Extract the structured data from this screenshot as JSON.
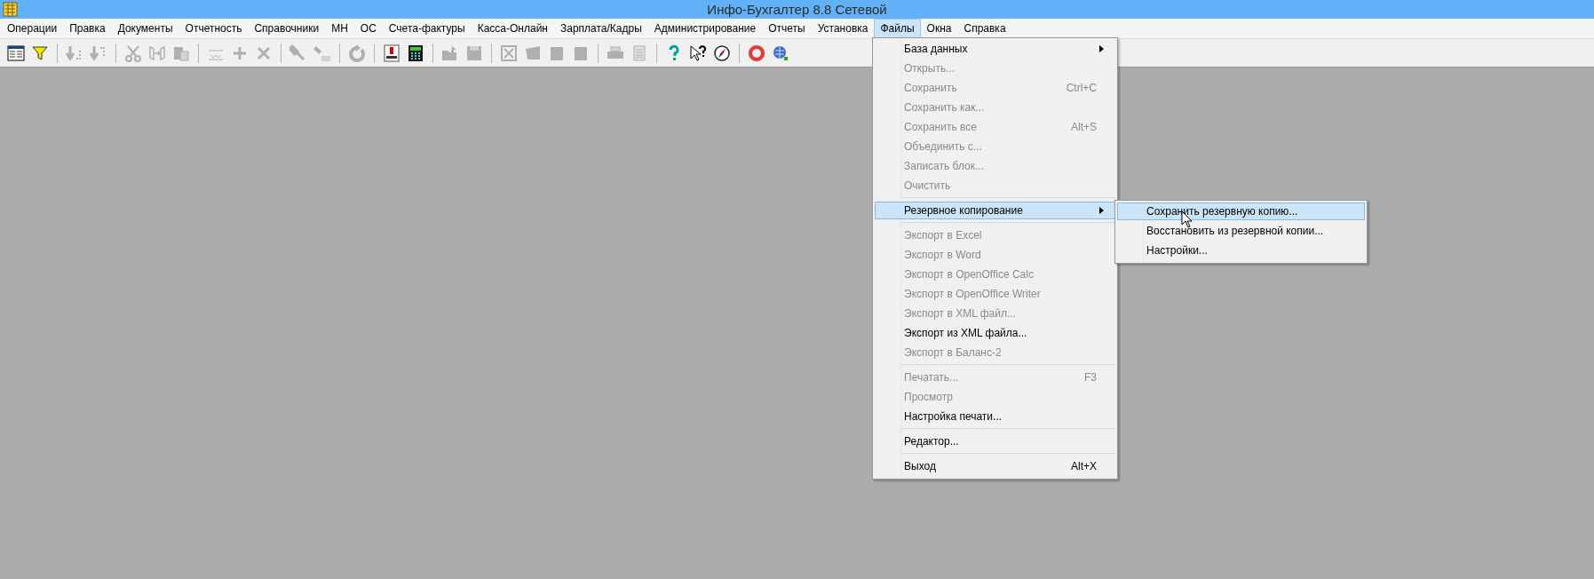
{
  "window": {
    "title": "Инфо-Бухгалтер 8.8 Сетевой"
  },
  "menu_bar": [
    {
      "label": "Операции",
      "selected": false
    },
    {
      "label": "Правка",
      "selected": false
    },
    {
      "label": "Документы",
      "selected": false
    },
    {
      "label": "Отчетность",
      "selected": false
    },
    {
      "label": "Справочники",
      "selected": false
    },
    {
      "label": "МН",
      "selected": false
    },
    {
      "label": "ОС",
      "selected": false
    },
    {
      "label": "Счета-фактуры",
      "selected": false
    },
    {
      "label": "Касса-Онлайн",
      "selected": false
    },
    {
      "label": "Зарплата/Кадры",
      "selected": false
    },
    {
      "label": "Администрирование",
      "selected": false
    },
    {
      "label": "Отчеты",
      "selected": false
    },
    {
      "label": "Установка",
      "selected": false
    },
    {
      "label": "Файлы",
      "selected": true
    },
    {
      "label": "Окна",
      "selected": false
    },
    {
      "label": "Справка",
      "selected": false
    }
  ],
  "toolbar": [
    [
      {
        "disabled": false
      },
      {
        "disabled": false
      }
    ],
    [
      {
        "disabled": true
      },
      {
        "disabled": true
      }
    ],
    [
      {
        "disabled": true
      },
      {
        "disabled": true
      },
      {
        "disabled": true
      }
    ],
    [
      {
        "disabled": true
      },
      {
        "disabled": true
      },
      {
        "disabled": true
      }
    ],
    [
      {
        "disabled": true
      },
      {
        "disabled": true
      }
    ],
    [
      {
        "disabled": true
      }
    ],
    [
      {
        "disabled": false
      },
      {
        "disabled": false
      }
    ],
    [
      {
        "disabled": true
      },
      {
        "disabled": true
      }
    ],
    [
      {
        "disabled": true
      },
      {
        "disabled": true
      },
      {
        "disabled": true
      },
      {
        "disabled": true
      }
    ],
    [
      {
        "disabled": true
      },
      {
        "disabled": true
      }
    ],
    [
      {
        "disabled": false
      },
      {
        "disabled": false
      },
      {
        "disabled": false
      }
    ],
    [
      {
        "disabled": false
      },
      {
        "disabled": false
      }
    ]
  ],
  "files_menu": [
    [
      {
        "label": "База данных",
        "disabled": false,
        "submenu": true,
        "selected": false
      },
      {
        "label": "Открыть...",
        "disabled": true,
        "submenu": false,
        "selected": false
      },
      {
        "label": "Сохранить",
        "shortcut": "Ctrl+C",
        "disabled": true,
        "submenu": false,
        "selected": false
      },
      {
        "label": "Сохранить как...",
        "disabled": true,
        "submenu": false,
        "selected": false
      },
      {
        "label": "Сохранить все",
        "shortcut": "Alt+S",
        "disabled": true,
        "submenu": false,
        "selected": false
      },
      {
        "label": "Объединить с...",
        "disabled": true,
        "submenu": false,
        "selected": false
      },
      {
        "label": "Записать блок...",
        "disabled": true,
        "submenu": false,
        "selected": false
      },
      {
        "label": "Очистить",
        "disabled": true,
        "submenu": false,
        "selected": false
      }
    ],
    [
      {
        "label": "Резервное копирование",
        "disabled": false,
        "submenu": true,
        "selected": true
      }
    ],
    [
      {
        "label": "Экспорт в Excel",
        "disabled": true,
        "submenu": false,
        "selected": false
      },
      {
        "label": "Экспорт в Word",
        "disabled": true,
        "submenu": false,
        "selected": false
      },
      {
        "label": "Экспорт в OpenOffice Calc",
        "disabled": true,
        "submenu": false,
        "selected": false
      },
      {
        "label": "Экспорт в OpenOffice Writer",
        "disabled": true,
        "submenu": false,
        "selected": false
      },
      {
        "label": "Экспорт в XML файл...",
        "disabled": true,
        "submenu": false,
        "selected": false
      },
      {
        "label": "Экспорт из XML файла...",
        "disabled": false,
        "submenu": false,
        "selected": false
      },
      {
        "label": "Экспорт в Баланс-2",
        "disabled": true,
        "submenu": false,
        "selected": false
      }
    ],
    [
      {
        "label": "Печатать...",
        "shortcut": "F3",
        "disabled": true,
        "submenu": false,
        "selected": false
      },
      {
        "label": "Просмотр",
        "disabled": true,
        "submenu": false,
        "selected": false
      },
      {
        "label": "Настройка печати...",
        "disabled": false,
        "submenu": false,
        "selected": false
      }
    ],
    [
      {
        "label": "Редактор...",
        "disabled": false,
        "submenu": false,
        "selected": false
      }
    ],
    [
      {
        "label": "Выход",
        "shortcut": "Alt+X",
        "disabled": false,
        "submenu": false,
        "selected": false
      }
    ]
  ],
  "backup_submenu": [
    {
      "label": "Сохранить резервную копию...",
      "selected": true
    },
    {
      "label": "Восстановить из резервной копии...",
      "selected": false
    },
    {
      "label": "Настройки...",
      "selected": false
    }
  ]
}
